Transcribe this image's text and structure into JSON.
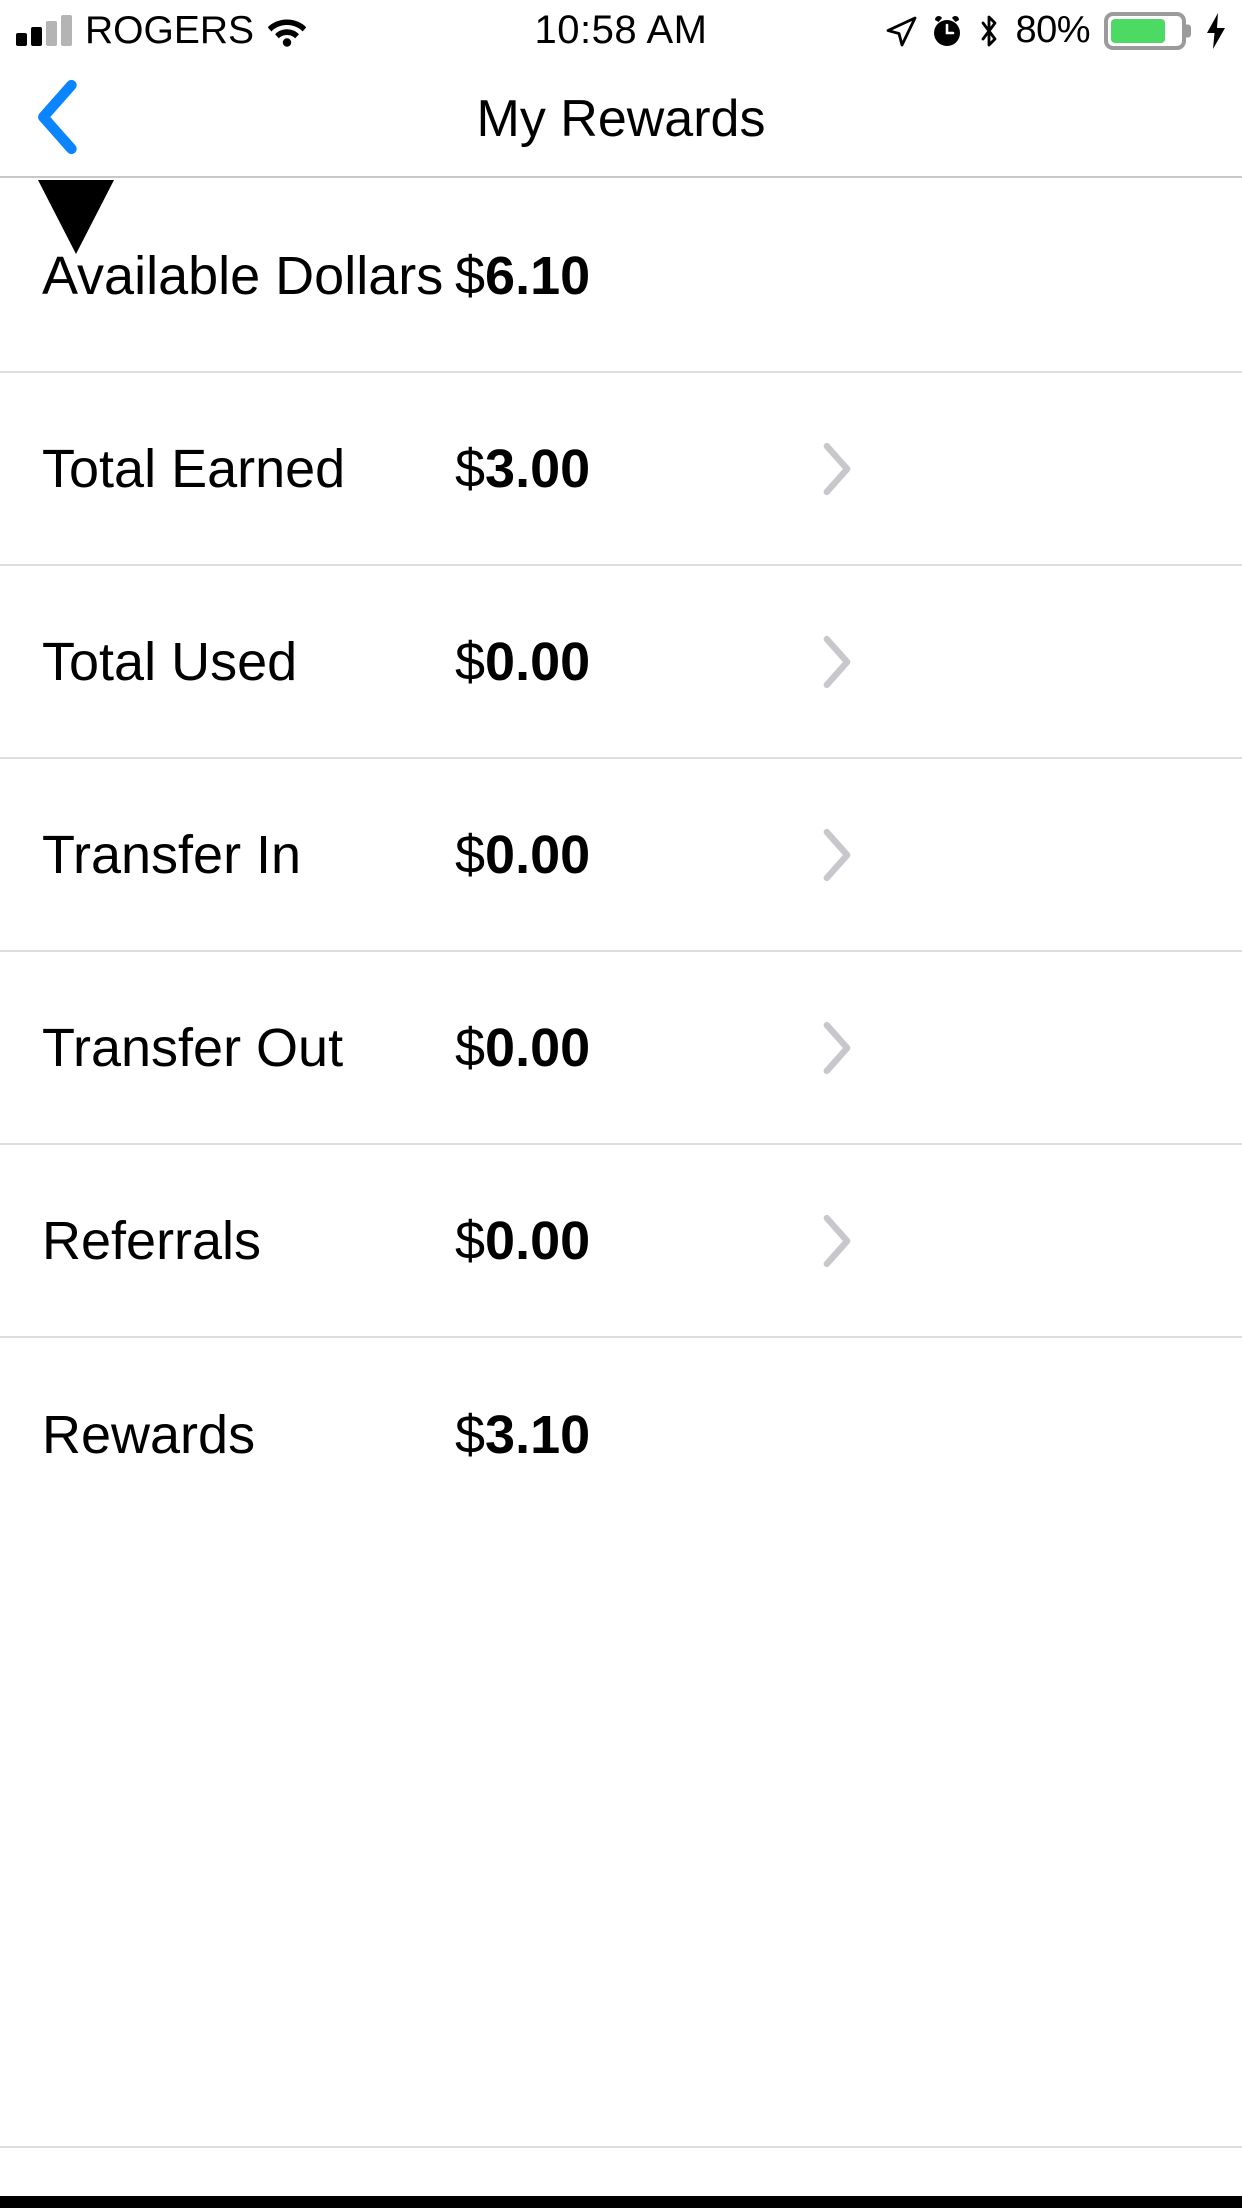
{
  "status_bar": {
    "carrier": "ROGERS",
    "time": "10:58 AM",
    "battery_percent": "80%",
    "battery_level": 80,
    "battery_fill_color": "#4CD964",
    "signal_bars_filled": 2,
    "signal_bars_total": 4,
    "icons": [
      "signal-bars-icon",
      "wifi-icon",
      "location-arrow-icon",
      "alarm-clock-icon",
      "bluetooth-icon",
      "battery-icon",
      "charging-bolt-icon"
    ]
  },
  "nav_bar": {
    "back_label": "‹",
    "title": "My Rewards",
    "accent_color": "#0a84ff"
  },
  "list": {
    "rows": [
      {
        "label": "Available Dollars",
        "currency": "$",
        "amount": "6.10",
        "has_chevron": false,
        "has_caret": true
      },
      {
        "label": "Total Earned",
        "currency": "$",
        "amount": "3.00",
        "has_chevron": true,
        "has_caret": false
      },
      {
        "label": "Total Used",
        "currency": "$",
        "amount": "0.00",
        "has_chevron": true,
        "has_caret": false
      },
      {
        "label": "Transfer In",
        "currency": "$",
        "amount": "0.00",
        "has_chevron": true,
        "has_caret": false
      },
      {
        "label": "Transfer Out",
        "currency": "$",
        "amount": "0.00",
        "has_chevron": true,
        "has_caret": false
      },
      {
        "label": "Referrals",
        "currency": "$",
        "amount": "0.00",
        "has_chevron": true,
        "has_caret": false
      },
      {
        "label": "Rewards",
        "currency": "$",
        "amount": "3.10",
        "has_chevron": false,
        "has_caret": false
      }
    ],
    "divider_color": "#dededf",
    "chevron_color": "#c7c7cc"
  }
}
